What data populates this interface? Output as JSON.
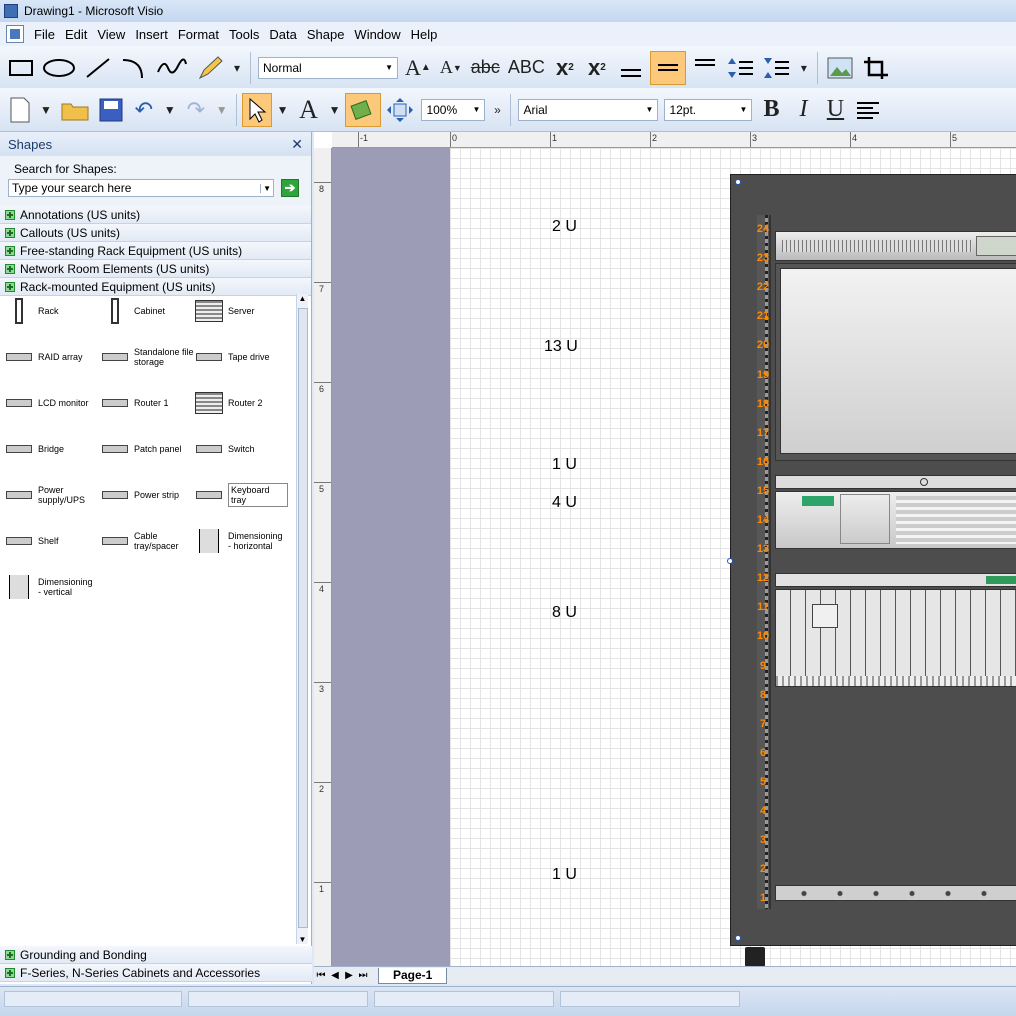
{
  "window": {
    "title": "Drawing1 - Microsoft Visio"
  },
  "menu": [
    "File",
    "Edit",
    "View",
    "Insert",
    "Format",
    "Tools",
    "Data",
    "Shape",
    "Window",
    "Help"
  ],
  "toolbar1": {
    "style": "Normal"
  },
  "toolbar2": {
    "zoom": "100%",
    "font": "Arial",
    "size": "12pt."
  },
  "shapes_panel": {
    "title": "Shapes",
    "search_label": "Search for Shapes:",
    "search_placeholder": "Type your search here",
    "stencils": [
      "Annotations (US units)",
      "Callouts (US units)",
      "Free-standing Rack Equipment (US units)",
      "Network Room Elements (US units)",
      "Rack-mounted Equipment (US units)"
    ],
    "masters": [
      {
        "label": "Rack",
        "icon": "rack-icon"
      },
      {
        "label": "Cabinet",
        "icon": "cabinet-icon"
      },
      {
        "label": "Server",
        "icon": "server-icon"
      },
      {
        "label": "RAID array",
        "icon": "raid-icon"
      },
      {
        "label": "Standalone file storage",
        "icon": "storage-icon"
      },
      {
        "label": "Tape drive",
        "icon": "tape-icon"
      },
      {
        "label": "LCD monitor",
        "icon": "lcd-icon"
      },
      {
        "label": "Router 1",
        "icon": "router-icon"
      },
      {
        "label": "Router 2",
        "icon": "router2-icon"
      },
      {
        "label": "Bridge",
        "icon": "bridge-icon"
      },
      {
        "label": "Patch panel",
        "icon": "patch-icon"
      },
      {
        "label": "Switch",
        "icon": "switch-icon"
      },
      {
        "label": "Power supply/UPS",
        "icon": "ups-icon"
      },
      {
        "label": "Power strip",
        "icon": "strip-icon"
      },
      {
        "label": "Keyboard tray",
        "icon": "keyboard-icon"
      },
      {
        "label": "Shelf",
        "icon": "shelf-icon"
      },
      {
        "label": "Cable tray/spacer",
        "icon": "cable-icon"
      },
      {
        "label": "Dimensioning - horizontal",
        "icon": "dim-h-icon"
      },
      {
        "label": "Dimensioning - vertical",
        "icon": "dim-v-icon"
      }
    ],
    "bottom_stencils": [
      "Grounding and Bonding",
      "F-Series, N-Series Cabinets and Accessories"
    ]
  },
  "ruler": {
    "h": [
      "-1",
      "0",
      "1",
      "2",
      "3",
      "4",
      "5"
    ],
    "v": [
      "8",
      "7",
      "6",
      "5",
      "4",
      "3",
      "2",
      "1"
    ]
  },
  "diagram": {
    "u_labels": [
      "2 U",
      "13 U",
      "1 U",
      "4 U",
      "8 U",
      "1 U"
    ],
    "rack_numbers": [
      "24",
      "23",
      "22",
      "21",
      "20",
      "19",
      "18",
      "17",
      "16",
      "15",
      "14",
      "13",
      "12",
      "11",
      "10",
      "9",
      "8",
      "7",
      "6",
      "5",
      "4",
      "3",
      "2",
      "1"
    ],
    "accent": "#ff8a00"
  },
  "page_tab": "Page-1"
}
